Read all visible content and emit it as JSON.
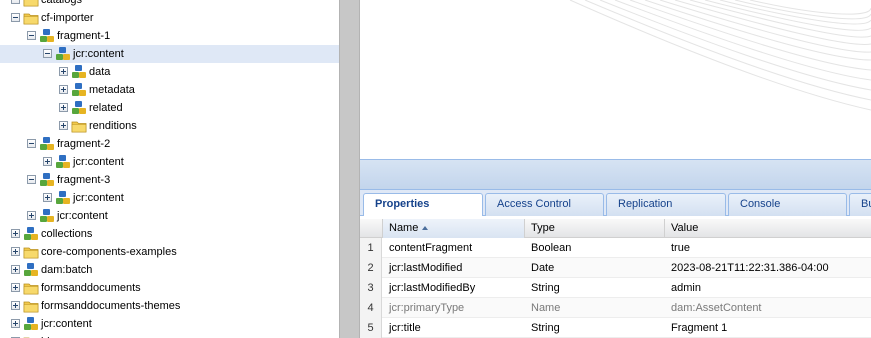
{
  "tree": {
    "nodes": [
      {
        "label": "catalogs",
        "icon": "folder",
        "toggle": "expanded",
        "depth": 1
      },
      {
        "label": "cf-importer",
        "icon": "folder",
        "toggle": "expanded",
        "depth": 1
      },
      {
        "label": "fragment-1",
        "icon": "node",
        "toggle": "expanded",
        "depth": 2
      },
      {
        "label": "jcr:content",
        "icon": "node",
        "toggle": "expanded",
        "depth": 3,
        "selected": true
      },
      {
        "label": "data",
        "icon": "node",
        "toggle": "collapsed",
        "depth": 4
      },
      {
        "label": "metadata",
        "icon": "node",
        "toggle": "collapsed",
        "depth": 4
      },
      {
        "label": "related",
        "icon": "node",
        "toggle": "collapsed",
        "depth": 4
      },
      {
        "label": "renditions",
        "icon": "folder",
        "toggle": "collapsed",
        "depth": 4
      },
      {
        "label": "fragment-2",
        "icon": "node",
        "toggle": "expanded",
        "depth": 2
      },
      {
        "label": "jcr:content",
        "icon": "node",
        "toggle": "collapsed",
        "depth": 3
      },
      {
        "label": "fragment-3",
        "icon": "node",
        "toggle": "expanded",
        "depth": 2
      },
      {
        "label": "jcr:content",
        "icon": "node",
        "toggle": "collapsed",
        "depth": 3
      },
      {
        "label": "jcr:content",
        "icon": "node",
        "toggle": "collapsed",
        "depth": 2
      },
      {
        "label": "collections",
        "icon": "node",
        "toggle": "collapsed",
        "depth": 1
      },
      {
        "label": "core-components-examples",
        "icon": "folder",
        "toggle": "collapsed",
        "depth": 1
      },
      {
        "label": "dam:batch",
        "icon": "node",
        "toggle": "collapsed",
        "depth": 1
      },
      {
        "label": "formsanddocuments",
        "icon": "folder",
        "toggle": "collapsed",
        "depth": 1
      },
      {
        "label": "formsanddocuments-themes",
        "icon": "folder",
        "toggle": "collapsed",
        "depth": 1
      },
      {
        "label": "jcr:content",
        "icon": "node",
        "toggle": "collapsed",
        "depth": 1
      },
      {
        "label": "ld-ecomm",
        "icon": "folder",
        "toggle": "collapsed",
        "depth": 1
      }
    ]
  },
  "tabs": [
    {
      "label": "Properties",
      "active": true
    },
    {
      "label": "Access Control",
      "active": false
    },
    {
      "label": "Replication",
      "active": false
    },
    {
      "label": "Console",
      "active": false
    },
    {
      "label": "Bu",
      "active": false
    }
  ],
  "grid": {
    "columns": [
      "Name",
      "Type",
      "Value"
    ],
    "sorted_column": "Name",
    "rows": [
      {
        "num": "1",
        "name": "contentFragment",
        "type": "Boolean",
        "value": "true",
        "muted": false
      },
      {
        "num": "2",
        "name": "jcr:lastModified",
        "type": "Date",
        "value": "2023-08-21T11:22:31.386-04:00",
        "muted": false
      },
      {
        "num": "3",
        "name": "jcr:lastModifiedBy",
        "type": "String",
        "value": "admin",
        "muted": false
      },
      {
        "num": "4",
        "name": "jcr:primaryType",
        "type": "Name",
        "value": "dam:AssetContent",
        "muted": true
      },
      {
        "num": "5",
        "name": "jcr:title",
        "type": "String",
        "value": "Fragment 1",
        "muted": false
      }
    ]
  },
  "colors": {
    "selection": "#dfe8f6",
    "tab_text": "#15428b",
    "folder": "#f1c84b",
    "node_blue": "#2f6fc2",
    "node_green": "#57a63c",
    "node_yellow": "#e6b422"
  }
}
